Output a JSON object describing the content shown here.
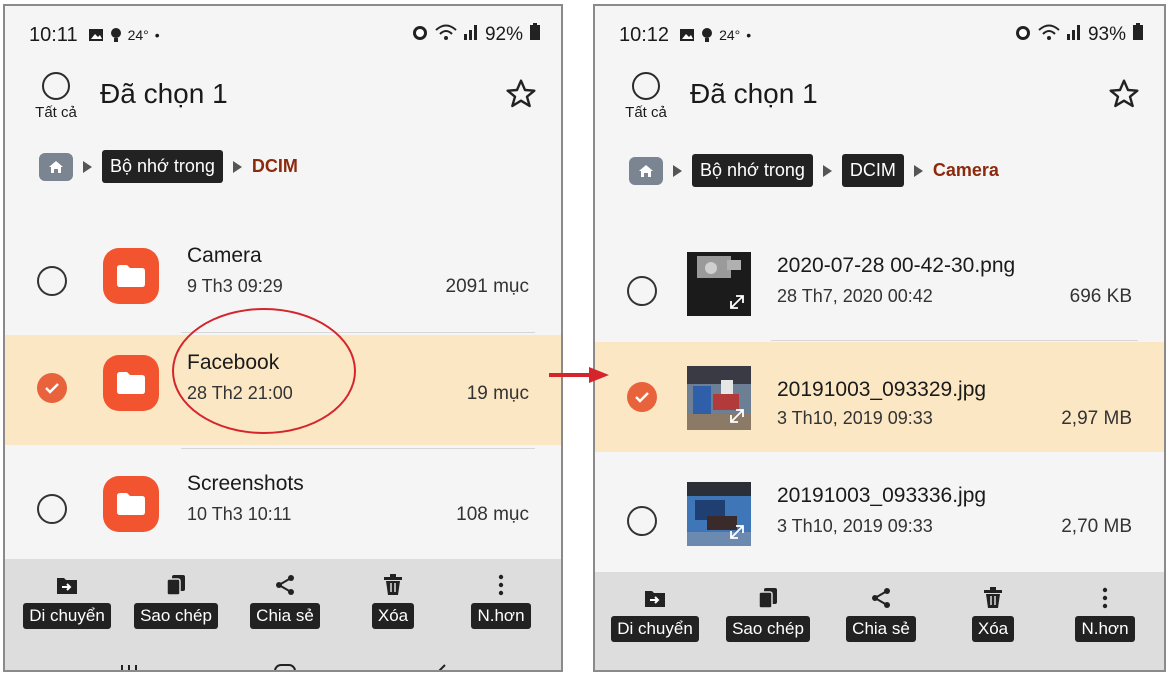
{
  "left": {
    "status": {
      "time": "10:11",
      "temp": "24°",
      "battery": "92%"
    },
    "header": {
      "select_all": "Tất cả",
      "title": "Đã chọn 1"
    },
    "breadcrumb": {
      "internal": "Bộ nhớ trong",
      "current": "DCIM"
    },
    "items": [
      {
        "name": "Camera",
        "date": "9 Th3 09:29",
        "count": "2091 mục",
        "selected": false
      },
      {
        "name": "Facebook",
        "date": "28 Th2 21:00",
        "count": "19 mục",
        "selected": true
      },
      {
        "name": "Screenshots",
        "date": "10 Th3 10:11",
        "count": "108 mục",
        "selected": false
      }
    ],
    "actions": [
      "Di chuyển",
      "Sao chép",
      "Chia sẻ",
      "Xóa",
      "N.hơn"
    ]
  },
  "right": {
    "status": {
      "time": "10:12",
      "temp": "24°",
      "battery": "93%"
    },
    "header": {
      "select_all": "Tất cả",
      "title": "Đã chọn 1"
    },
    "breadcrumb": {
      "internal": "Bộ nhớ trong",
      "dcim": "DCIM",
      "current": "Camera"
    },
    "items": [
      {
        "name": "2020-07-28 00-42-30.png",
        "date": "28 Th7, 2020 00:42",
        "size": "696 KB",
        "selected": false
      },
      {
        "name": "20191003_093329.jpg",
        "date": "3 Th10, 2019 09:33",
        "size": "2,97 MB",
        "selected": true
      },
      {
        "name": "20191003_093336.jpg",
        "date": "3 Th10, 2019 09:33",
        "size": "2,70 MB",
        "selected": false
      }
    ],
    "actions": [
      "Di chuyển",
      "Sao chép",
      "Chia sẻ",
      "Xóa",
      "N.hơn"
    ]
  },
  "colors": {
    "accent": "#f1542f",
    "selected_bg": "#fbe7c4",
    "highlight": "#d4252d",
    "crumb_current": "#8c2a0e"
  },
  "icons": [
    "home-icon",
    "star-icon",
    "folder-icon",
    "check-icon",
    "move-icon",
    "copy-icon",
    "share-icon",
    "trash-icon",
    "more-icon",
    "expand-icon"
  ]
}
